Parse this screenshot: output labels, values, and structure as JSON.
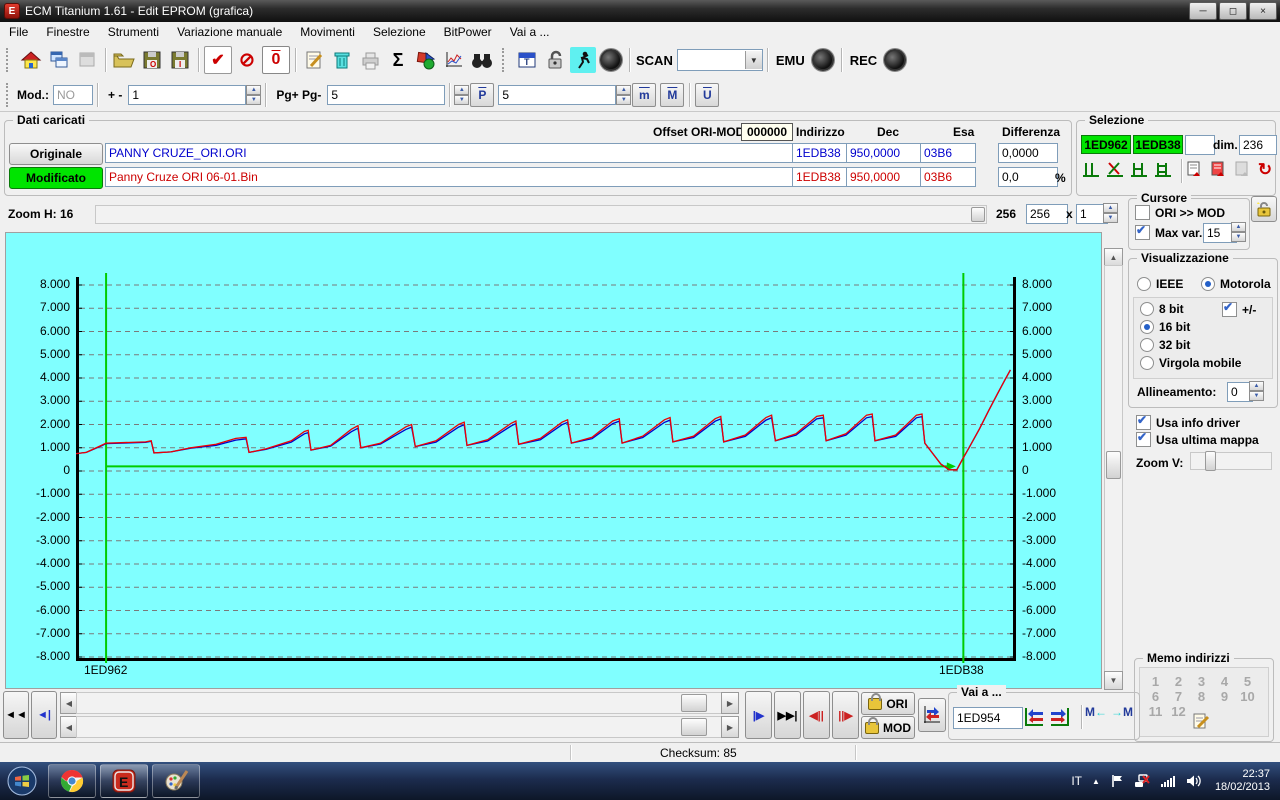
{
  "window": {
    "title": "ECM Titanium 1.61 - Edit EPROM (grafica)"
  },
  "menu": {
    "items": [
      "File",
      "Finestre",
      "Strumenti",
      "Variazione manuale",
      "Movimenti",
      "Selezione",
      "BitPower",
      "Vai a ..."
    ]
  },
  "toolbar1": {
    "scan_label": "SCAN",
    "emu_label": "EMU",
    "rec_label": "REC",
    "sigma": "Σ"
  },
  "toolbar2": {
    "mod_label": "Mod.:",
    "mod_value": "NO",
    "plusminus_label": "+ -",
    "step_value": "1",
    "pg_label": "Pg+ Pg-",
    "pg_value": "5",
    "p_icon": "P",
    "p_value": "5",
    "m_icon": "m",
    "M_icon": "M",
    "U_icon": "U"
  },
  "dati": {
    "title": "Dati caricati",
    "originale_label": "Originale",
    "originale_file": "PANNY CRUZE_ORI.ORI",
    "modificato_label": "Modificato",
    "modificato_file": "Panny Cruze ORI 06-01.Bin",
    "offset_label": "Offset ORI-MOD",
    "offset_value": "000000",
    "columns": {
      "indirizzo": "Indirizzo",
      "dec": "Dec",
      "esa": "Esa",
      "diff": "Differenza"
    },
    "ori_row": {
      "indirizzo": "1EDB38",
      "dec": "950,0000",
      "esa": "03B6",
      "diff": "0,0000"
    },
    "mod_row": {
      "indirizzo": "1EDB38",
      "dec": "950,0000",
      "esa": "03B6",
      "diff": "0,0"
    },
    "percent": "%"
  },
  "selezione": {
    "title": "Selezione",
    "start": "1ED962",
    "end": "1EDB38",
    "dim_label": "dim.",
    "dim_value": "236"
  },
  "zoomh": {
    "label": "Zoom H: 16",
    "pages": "256",
    "size_value": "256",
    "x_label": "x",
    "mult_value": "1"
  },
  "cursore": {
    "title": "Cursore",
    "orimod_label": "ORI >> MOD",
    "maxvar_label": "Max var.",
    "maxvar_value": "15"
  },
  "visualizzazione": {
    "title": "Visualizzazione",
    "ieee": "IEEE",
    "motorola": "Motorola",
    "bit8": "8 bit",
    "plusminus": "+/-",
    "bit16": "16 bit",
    "bit32": "32 bit",
    "virgola": "Virgola mobile",
    "allineamento_label": "Allineamento:",
    "allineamento_value": "0",
    "usa_info": "Usa info driver",
    "usa_mappa": "Usa ultima mappa",
    "zoomv_label": "Zoom V:"
  },
  "memo": {
    "title": "Memo indirizzi",
    "slots": [
      "1",
      "2",
      "3",
      "4",
      "5",
      "6",
      "7",
      "8",
      "9",
      "10",
      "11",
      "12"
    ]
  },
  "bottom": {
    "ori_label": "ORI",
    "mod_label": "MOD",
    "vai_title": "Vai a ...",
    "vai_value": "1ED954"
  },
  "statusbar": {
    "checksum": "Checksum: 85"
  },
  "taskbar": {
    "lang": "IT",
    "time": "22:37",
    "date": "18/02/2013"
  },
  "chart_data": {
    "type": "line",
    "title": "",
    "xlabel": "",
    "ylabel": "",
    "ylim": [
      -8000,
      8000
    ],
    "grid": "dashed",
    "background": "#80ffff",
    "ytick_values": [
      8000,
      7000,
      6000,
      5000,
      4000,
      3000,
      2000,
      1000,
      0,
      -1000,
      -2000,
      -3000,
      -4000,
      -5000,
      -6000,
      -7000,
      -8000
    ],
    "ytick_labels": [
      "8.000",
      "7.000",
      "6.000",
      "5.000",
      "4.000",
      "3.000",
      "2.000",
      "1.000",
      "0",
      "-1.000",
      "-2.000",
      "-3.000",
      "-4.000",
      "-5.000",
      "-6.000",
      "-7.000",
      "-8.000"
    ],
    "x_start_label": "1ED962",
    "x_end_label": "1EDB38",
    "cursors": {
      "color": "#00cc00",
      "positions": [
        0.032,
        0.944
      ],
      "labels": [
        "1ED962",
        "1EDB38"
      ]
    },
    "hline": {
      "color": "#00cc00",
      "value": 200,
      "from": 0.032,
      "to": 0.936,
      "arrow": true
    },
    "series": [
      {
        "name": "Originale",
        "color": "#0000cc",
        "points": [
          [
            0.0,
            750
          ],
          [
            0.011,
            800
          ],
          [
            0.027,
            1080
          ],
          [
            0.032,
            1180
          ],
          [
            0.074,
            1230
          ],
          [
            0.08,
            1280
          ],
          [
            0.083,
            780
          ],
          [
            0.101,
            820
          ],
          [
            0.122,
            980
          ],
          [
            0.149,
            1100
          ],
          [
            0.17,
            1330
          ],
          [
            0.181,
            1380
          ],
          [
            0.184,
            800
          ],
          [
            0.202,
            930
          ],
          [
            0.229,
            1240
          ],
          [
            0.243,
            1600
          ],
          [
            0.247,
            1650
          ],
          [
            0.25,
            900
          ],
          [
            0.271,
            1070
          ],
          [
            0.293,
            1690
          ],
          [
            0.3,
            1840
          ],
          [
            0.303,
            1000
          ],
          [
            0.324,
            1160
          ],
          [
            0.351,
            1790
          ],
          [
            0.357,
            1890
          ],
          [
            0.361,
            1050
          ],
          [
            0.383,
            1240
          ],
          [
            0.407,
            1890
          ],
          [
            0.413,
            1990
          ],
          [
            0.416,
            1100
          ],
          [
            0.438,
            1290
          ],
          [
            0.463,
            1940
          ],
          [
            0.468,
            2040
          ],
          [
            0.471,
            1150
          ],
          [
            0.494,
            1340
          ],
          [
            0.517,
            1990
          ],
          [
            0.523,
            2090
          ],
          [
            0.527,
            1200
          ],
          [
            0.549,
            1390
          ],
          [
            0.571,
            2040
          ],
          [
            0.578,
            2140
          ],
          [
            0.581,
            1200
          ],
          [
            0.603,
            1440
          ],
          [
            0.626,
            2090
          ],
          [
            0.632,
            2190
          ],
          [
            0.635,
            1250
          ],
          [
            0.657,
            1440
          ],
          [
            0.68,
            2140
          ],
          [
            0.686,
            2240
          ],
          [
            0.689,
            1250
          ],
          [
            0.712,
            1490
          ],
          [
            0.734,
            2190
          ],
          [
            0.74,
            2290
          ],
          [
            0.744,
            1300
          ],
          [
            0.766,
            1540
          ],
          [
            0.788,
            2240
          ],
          [
            0.795,
            2290
          ],
          [
            0.798,
            1300
          ],
          [
            0.819,
            1540
          ],
          [
            0.841,
            2290
          ],
          [
            0.847,
            2340
          ],
          [
            0.85,
            1300
          ],
          [
            0.872,
            1490
          ],
          [
            0.894,
            2290
          ],
          [
            0.9,
            2340
          ],
          [
            0.903,
            1200
          ],
          [
            0.92,
            300
          ],
          [
            0.929,
            50
          ],
          [
            0.937,
            50
          ],
          [
            0.943,
            500
          ],
          [
            0.95,
            1000
          ],
          [
            0.961,
            1800
          ],
          [
            0.971,
            2600
          ],
          [
            0.98,
            3300
          ],
          [
            0.988,
            3900
          ],
          [
            0.994,
            4350
          ]
        ]
      },
      {
        "name": "Modificato",
        "color": "#ee0000",
        "points": [
          [
            0.0,
            750
          ],
          [
            0.011,
            800
          ],
          [
            0.027,
            1100
          ],
          [
            0.032,
            1200
          ],
          [
            0.074,
            1250
          ],
          [
            0.08,
            1300
          ],
          [
            0.083,
            780
          ],
          [
            0.101,
            820
          ],
          [
            0.122,
            1000
          ],
          [
            0.149,
            1150
          ],
          [
            0.17,
            1400
          ],
          [
            0.181,
            1450
          ],
          [
            0.184,
            800
          ],
          [
            0.202,
            950
          ],
          [
            0.229,
            1300
          ],
          [
            0.243,
            1700
          ],
          [
            0.247,
            1750
          ],
          [
            0.25,
            900
          ],
          [
            0.271,
            1100
          ],
          [
            0.293,
            1800
          ],
          [
            0.3,
            1950
          ],
          [
            0.303,
            1000
          ],
          [
            0.324,
            1200
          ],
          [
            0.351,
            1900
          ],
          [
            0.357,
            2000
          ],
          [
            0.361,
            1050
          ],
          [
            0.383,
            1300
          ],
          [
            0.407,
            2000
          ],
          [
            0.413,
            2100
          ],
          [
            0.416,
            1100
          ],
          [
            0.438,
            1350
          ],
          [
            0.463,
            2050
          ],
          [
            0.468,
            2150
          ],
          [
            0.471,
            1150
          ],
          [
            0.494,
            1400
          ],
          [
            0.517,
            2100
          ],
          [
            0.523,
            2200
          ],
          [
            0.527,
            1200
          ],
          [
            0.549,
            1450
          ],
          [
            0.571,
            2150
          ],
          [
            0.578,
            2250
          ],
          [
            0.581,
            1200
          ],
          [
            0.603,
            1500
          ],
          [
            0.626,
            2200
          ],
          [
            0.632,
            2300
          ],
          [
            0.635,
            1250
          ],
          [
            0.657,
            1500
          ],
          [
            0.68,
            2250
          ],
          [
            0.686,
            2350
          ],
          [
            0.689,
            1250
          ],
          [
            0.712,
            1550
          ],
          [
            0.734,
            2300
          ],
          [
            0.74,
            2400
          ],
          [
            0.744,
            1300
          ],
          [
            0.766,
            1600
          ],
          [
            0.788,
            2350
          ],
          [
            0.795,
            2400
          ],
          [
            0.798,
            1300
          ],
          [
            0.819,
            1600
          ],
          [
            0.841,
            2400
          ],
          [
            0.847,
            2450
          ],
          [
            0.85,
            1300
          ],
          [
            0.872,
            1550
          ],
          [
            0.894,
            2400
          ],
          [
            0.9,
            2450
          ],
          [
            0.903,
            1200
          ],
          [
            0.92,
            300
          ],
          [
            0.929,
            50
          ],
          [
            0.937,
            50
          ],
          [
            0.943,
            500
          ],
          [
            0.95,
            1000
          ],
          [
            0.961,
            1800
          ],
          [
            0.971,
            2600
          ],
          [
            0.98,
            3300
          ],
          [
            0.988,
            3900
          ],
          [
            0.994,
            4350
          ]
        ]
      }
    ]
  }
}
